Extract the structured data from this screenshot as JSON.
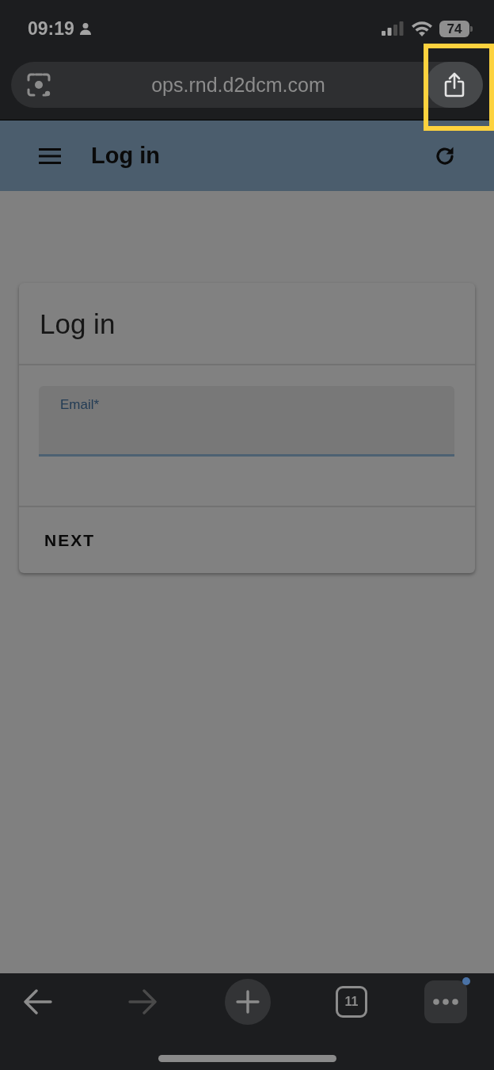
{
  "status_bar": {
    "time": "09:19",
    "battery": "74"
  },
  "browser": {
    "url": "ops.rnd.d2dcm.com",
    "share_button": {
      "highlighted": true
    }
  },
  "app_bar": {
    "title": "Log in"
  },
  "card": {
    "title": "Log in",
    "field": {
      "label": "Email*"
    },
    "button": "NEXT"
  },
  "toolbar": {
    "nav": [
      {
        "kind": "back",
        "disabled": false
      },
      {
        "kind": "forward",
        "disabled": true
      }
    ],
    "tab_count": "11",
    "menu_notification": true
  }
}
